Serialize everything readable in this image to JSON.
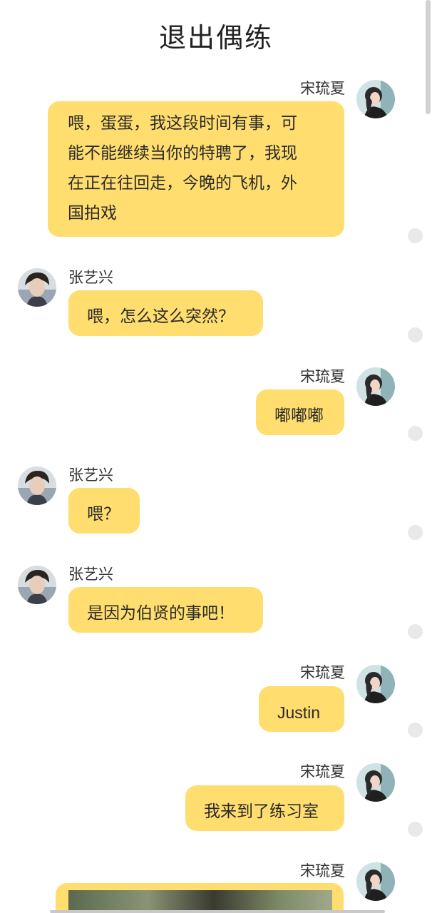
{
  "header": {
    "title": "退出偶练"
  },
  "contacts": {
    "female": {
      "name": "宋琉夏",
      "avatar_icon": "female-avatar"
    },
    "male": {
      "name": "张艺兴",
      "avatar_icon": "male-avatar"
    }
  },
  "messages": [
    {
      "sender": "宋琉夏",
      "side": "right",
      "lines": [
        "喂，蛋蛋，我这段时间有事，可",
        "能不能继续当你的特聘了，我现",
        "在正在往回走，今晚的飞机，外",
        "国拍戏"
      ]
    },
    {
      "sender": "张艺兴",
      "side": "left",
      "text": "喂，怎么这么突然？"
    },
    {
      "sender": "宋琉夏",
      "side": "right",
      "text": "嘟嘟嘟"
    },
    {
      "sender": "张艺兴",
      "side": "left",
      "text": "喂？"
    },
    {
      "sender": "张艺兴",
      "side": "left",
      "text": "是因为伯贤的事吧！"
    },
    {
      "sender": "宋琉夏",
      "side": "right",
      "text": "Justin"
    },
    {
      "sender": "宋琉夏",
      "side": "right",
      "text": "我来到了练习室"
    },
    {
      "sender": "宋琉夏",
      "side": "right",
      "type": "image"
    }
  ],
  "colors": {
    "bubble": "#ffdd6e",
    "dot": "#e9e9e9",
    "text": "#2a2a2a"
  }
}
